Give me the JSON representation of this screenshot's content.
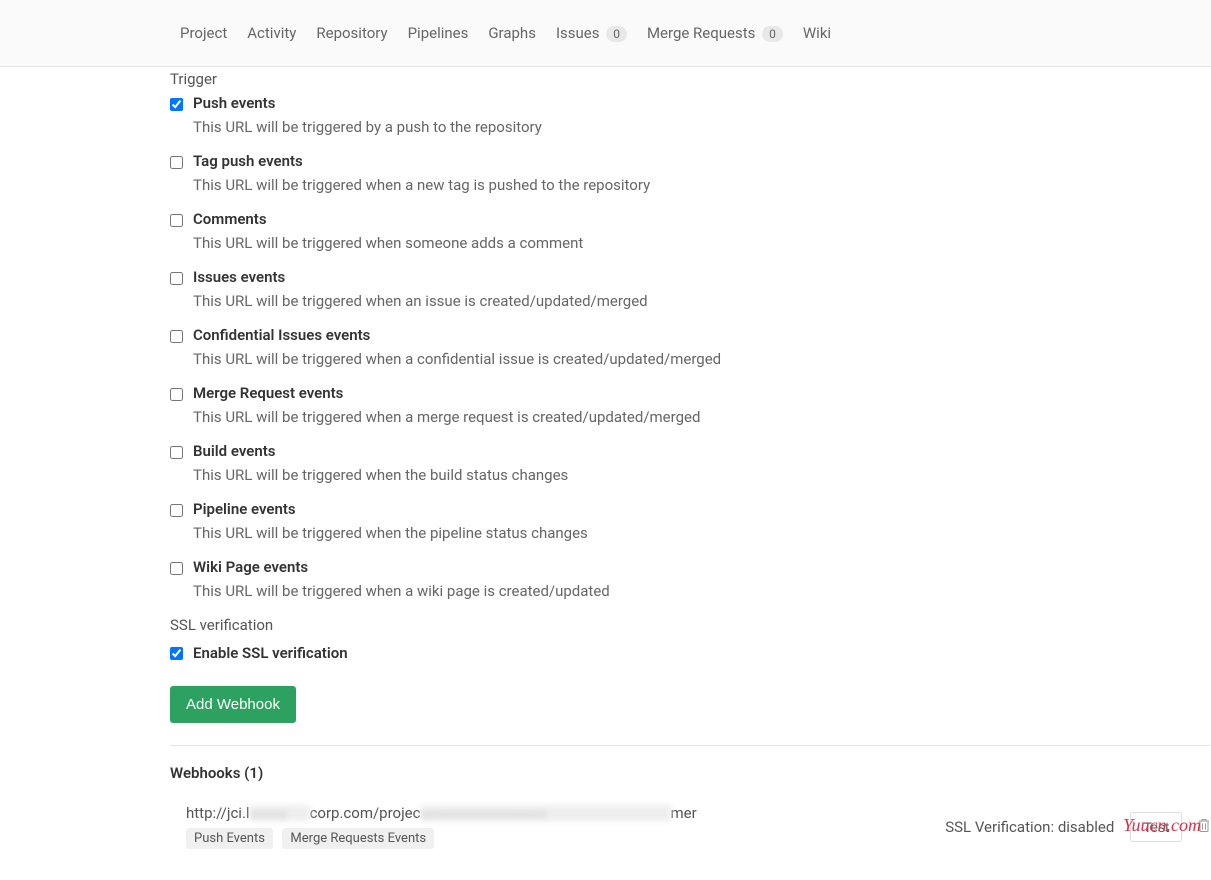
{
  "nav": {
    "project": "Project",
    "activity": "Activity",
    "repository": "Repository",
    "pipelines": "Pipelines",
    "graphs": "Graphs",
    "issues": "Issues",
    "issues_count": "0",
    "merge_requests": "Merge Requests",
    "mr_count": "0",
    "wiki": "Wiki"
  },
  "trigger_label": "Trigger",
  "triggers": [
    {
      "checked": true,
      "title": "Push events",
      "desc": "This URL will be triggered by a push to the repository"
    },
    {
      "checked": false,
      "title": "Tag push events",
      "desc": "This URL will be triggered when a new tag is pushed to the repository"
    },
    {
      "checked": false,
      "title": "Comments",
      "desc": "This URL will be triggered when someone adds a comment"
    },
    {
      "checked": false,
      "title": "Issues events",
      "desc": "This URL will be triggered when an issue is created/updated/merged"
    },
    {
      "checked": false,
      "title": "Confidential Issues events",
      "desc": "This URL will be triggered when a confidential issue is created/updated/merged"
    },
    {
      "checked": false,
      "title": "Merge Request events",
      "desc": "This URL will be triggered when a merge request is created/updated/merged"
    },
    {
      "checked": false,
      "title": "Build events",
      "desc": "This URL will be triggered when the build status changes"
    },
    {
      "checked": false,
      "title": "Pipeline events",
      "desc": "This URL will be triggered when the pipeline status changes"
    },
    {
      "checked": false,
      "title": "Wiki Page events",
      "desc": "This URL will be triggered when a wiki page is created/updated"
    }
  ],
  "ssl": {
    "label": "SSL verification",
    "enable_label": "Enable SSL verification",
    "checked": true
  },
  "add_button": "Add Webhook",
  "webhooks": {
    "header": "Webhooks (1)",
    "url_prefix": "http://jci.l",
    "url_mid": "corp.com/projec",
    "url_suffix": "mer",
    "tags": [
      "Push Events",
      "Merge Requests Events"
    ],
    "ssl_status": "SSL Verification: disabled",
    "test_label": "Test"
  },
  "watermark": "Yuucn.com"
}
